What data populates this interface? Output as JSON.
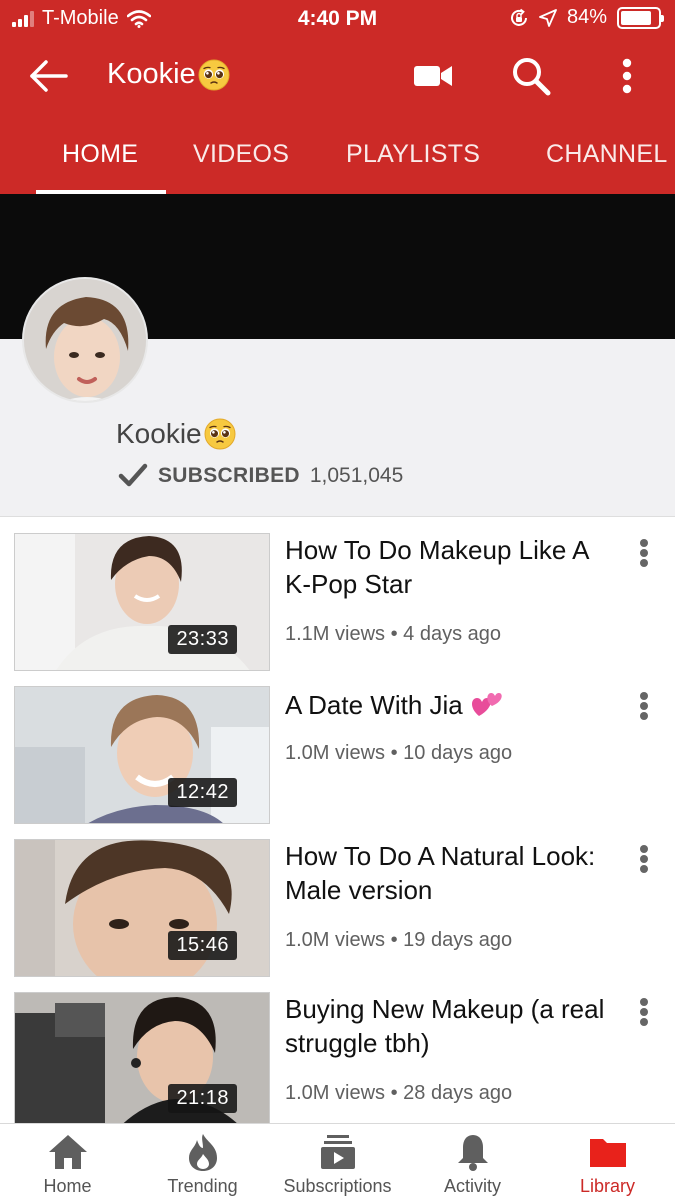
{
  "status_bar": {
    "carrier": "T-Mobile",
    "time": "4:40 PM",
    "battery_percent": "84%",
    "battery_level": 0.84
  },
  "toolbar": {
    "title": "Kookie",
    "icons": [
      "back-arrow-icon",
      "video-camera-icon",
      "search-icon",
      "more-vert-icon"
    ]
  },
  "tabs": [
    "HOME",
    "VIDEOS",
    "PLAYLISTS",
    "CHANNEL"
  ],
  "active_tab": "HOME",
  "channel": {
    "name": "Kookie",
    "subscribed_label": "SUBSCRIBED",
    "subscriber_count": "1,051,045"
  },
  "videos": [
    {
      "title": "How To Do Makeup Like A K-Pop Star",
      "views": "1.1M views",
      "age": "4 days ago",
      "duration": "23:33"
    },
    {
      "title": "A Date With Jia",
      "views": "1.0M views",
      "age": "10 days ago",
      "duration": "12:42"
    },
    {
      "title": "How To Do A Natural Look: Male version",
      "views": "1.0M views",
      "age": "19 days ago",
      "duration": "15:46"
    },
    {
      "title": "Buying New Makeup (a real struggle tbh)",
      "views": "1.0M views",
      "age": "28 days ago",
      "duration": "21:18"
    }
  ],
  "meta_separator": "•",
  "bottom_nav": [
    {
      "label": "Home",
      "icon": "home-icon"
    },
    {
      "label": "Trending",
      "icon": "flame-icon"
    },
    {
      "label": "Subscriptions",
      "icon": "subscriptions-icon"
    },
    {
      "label": "Activity",
      "icon": "bell-icon"
    },
    {
      "label": "Library",
      "icon": "folder-icon"
    }
  ],
  "active_nav": "Library",
  "colors": {
    "brand_red": "#cc2a27",
    "text_gray": "#606060"
  }
}
